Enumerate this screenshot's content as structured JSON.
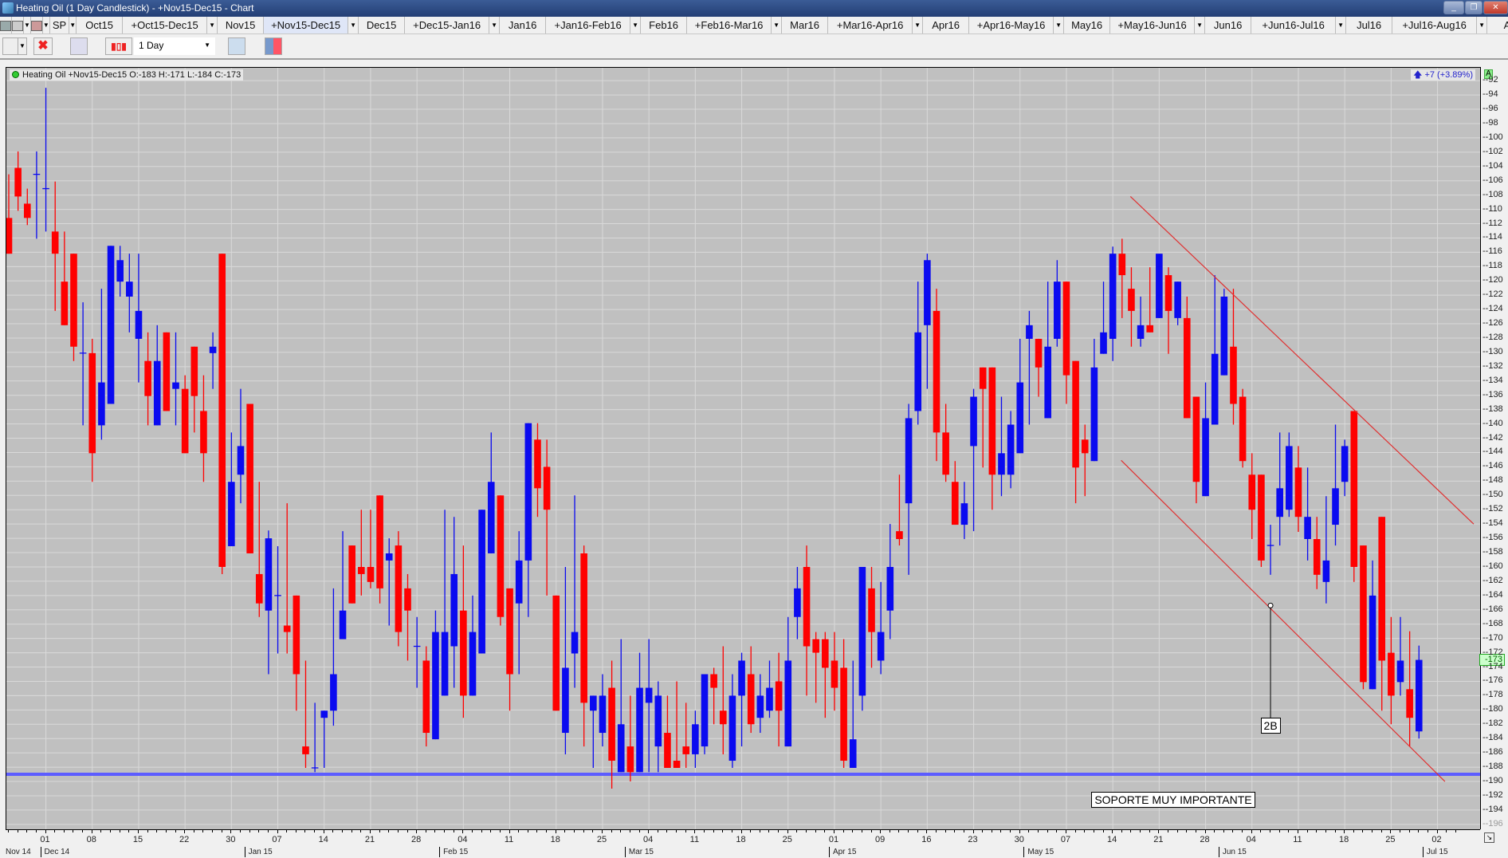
{
  "window": {
    "title": "Heating Oil (1 Day Candlestick) - +Nov15-Dec15 - Chart",
    "minimize": "_",
    "restore": "❐",
    "close": "✕"
  },
  "tabs": {
    "sp_label": "SP",
    "items": [
      {
        "label": "Oct15",
        "type": "plain"
      },
      {
        "label": "+Oct15-Dec15",
        "type": "spread"
      },
      {
        "label": "Nov15",
        "type": "plain"
      },
      {
        "label": "+Nov15-Dec15",
        "type": "spread",
        "selected": true
      },
      {
        "label": "Dec15",
        "type": "plain"
      },
      {
        "label": "+Dec15-Jan16",
        "type": "spread"
      },
      {
        "label": "Jan16",
        "type": "plain"
      },
      {
        "label": "+Jan16-Feb16",
        "type": "spread"
      },
      {
        "label": "Feb16",
        "type": "plain"
      },
      {
        "label": "+Feb16-Mar16",
        "type": "spread"
      },
      {
        "label": "Mar16",
        "type": "plain"
      },
      {
        "label": "+Mar16-Apr16",
        "type": "spread"
      },
      {
        "label": "Apr16",
        "type": "plain"
      },
      {
        "label": "+Apr16-May16",
        "type": "spread"
      },
      {
        "label": "May16",
        "type": "plain"
      },
      {
        "label": "+May16-Jun16",
        "type": "spread"
      },
      {
        "label": "Jun16",
        "type": "plain"
      },
      {
        "label": "+Jun16-Jul16",
        "type": "spread"
      },
      {
        "label": "Jul16",
        "type": "plain"
      },
      {
        "label": "+Jul16-Aug16",
        "type": "spread"
      },
      {
        "label": "Au",
        "type": "plain"
      }
    ]
  },
  "toolbar": {
    "interval": "1 Day"
  },
  "chart_header": {
    "legend": "Heating Oil +Nov15-Dec15 O:-183 H:-171 L:-184 C:-173",
    "change": "+7 (+3.89%)",
    "axis_badge": "A",
    "last_price": "-173"
  },
  "colors": {
    "up": "#0a0af0",
    "down": "#ff0000",
    "background": "#c0c0c0",
    "grid": "#d9d9d9",
    "support": "#5c5cff",
    "trendline": "#e03030"
  },
  "chart_data": {
    "type": "candlestick",
    "title": "Heating Oil +Nov15-Dec15",
    "ylim": [
      -90.2,
      -196.8
    ],
    "yticks_step": 2,
    "yticks_range": [
      -92,
      -196
    ],
    "grid": true,
    "ohlc": [
      [
        -111.2,
        -105.1,
        -116.2,
        -116.2
      ],
      [
        -104.2,
        -101.9,
        -110.2,
        -108.2
      ],
      [
        -109.2,
        -107.1,
        -112.2,
        -111.2
      ],
      [
        -105.1,
        -101.9,
        -114.1,
        -105.1
      ],
      [
        -107.1,
        -93,
        -113.1,
        -107.1
      ],
      [
        -113.1,
        -106.1,
        -124.2,
        -116.2
      ],
      [
        -120.1,
        -113.1,
        -126.2,
        -126.2
      ],
      [
        -116.2,
        -116.2,
        -131.2,
        -129.2
      ],
      [
        -130.1,
        -123,
        -140.2,
        -130.1
      ],
      [
        -130.1,
        -128.1,
        -148.1,
        -144.1
      ],
      [
        -140.2,
        -121.1,
        -142.2,
        -134.2
      ],
      [
        -137.2,
        -115.1,
        -137.2,
        -115.1
      ],
      [
        -120.1,
        -115.1,
        -122.2,
        -117.1
      ],
      [
        -122.2,
        -116.2,
        -127.2,
        -120.1
      ],
      [
        -128.1,
        -116.2,
        -134.2,
        -124.2
      ],
      [
        -131.2,
        -127.2,
        -140.2,
        -136.1
      ],
      [
        -140.2,
        -126.2,
        -140.2,
        -131.2
      ],
      [
        -127.2,
        -127.2,
        -138.2,
        -138.2
      ],
      [
        -135.1,
        -127.2,
        -140.2,
        -134.2
      ],
      [
        -135.1,
        -133.2,
        -144.1,
        -144.1
      ],
      [
        -129.2,
        -129.2,
        -141.2,
        -136.1
      ],
      [
        -138.2,
        -133.2,
        -148.1,
        -144.1
      ],
      [
        -130.1,
        -127.2,
        -135.1,
        -129.2
      ],
      [
        -116.2,
        -116.2,
        -161,
        -160
      ],
      [
        -157.1,
        -141.2,
        -157.1,
        -148.1
      ],
      [
        -147.1,
        -135.1,
        -151.1,
        -143.1
      ],
      [
        -137.2,
        -137.2,
        -158.1,
        -158.1
      ],
      [
        -161,
        -148.1,
        -167,
        -165.1
      ],
      [
        -166.1,
        -154.9,
        -175,
        -156
      ],
      [
        -164,
        -157.1,
        -172.1,
        -164
      ],
      [
        -168.2,
        -151.1,
        -172.1,
        -169.1
      ],
      [
        -164,
        -164,
        -180.1,
        -175
      ],
      [
        -185.1,
        -173.1,
        -188.1,
        -186.2
      ],
      [
        -188.1,
        -179,
        -188.7,
        -188.1
      ],
      [
        -181.1,
        -180.1,
        -188.1,
        -180.1
      ],
      [
        -180.1,
        -163,
        -182.2,
        -175
      ],
      [
        -170.1,
        -155,
        -170.1,
        -166.1
      ],
      [
        -157,
        -157,
        -165.1,
        -165.1
      ],
      [
        -160,
        -152,
        -164,
        -161
      ],
      [
        -160,
        -152,
        -163,
        -162.1
      ],
      [
        -150,
        -150,
        -165.1,
        -163
      ],
      [
        -159.1,
        -156,
        -168.2,
        -158.1
      ],
      [
        -157,
        -155,
        -171.1,
        -169.1
      ],
      [
        -163,
        -161,
        -173.1,
        -166.1
      ],
      [
        -171.1,
        -167,
        -176.9,
        -171.1
      ],
      [
        -173.1,
        -171.1,
        -185.1,
        -183.2
      ],
      [
        -184.1,
        -166.1,
        -184.1,
        -169.1
      ],
      [
        -178,
        -152,
        -178,
        -169.1
      ],
      [
        -171.1,
        -153,
        -176.9,
        -161
      ],
      [
        -166.1,
        -157,
        -181.1,
        -178
      ],
      [
        -178,
        -164,
        -178,
        -169.1
      ],
      [
        -172.1,
        -152,
        -172.1,
        -152
      ],
      [
        -158.1,
        -141.2,
        -158.1,
        -148.1
      ],
      [
        -150,
        -150,
        -168.2,
        -167
      ],
      [
        -163,
        -163,
        -180.1,
        -175
      ],
      [
        -165.1,
        -155,
        -175,
        -159.1
      ],
      [
        -159.1,
        -139.9,
        -167,
        -139.9
      ],
      [
        -142.2,
        -139.9,
        -153,
        -149
      ],
      [
        -146,
        -142.2,
        -164,
        -152
      ],
      [
        -164,
        -164,
        -180.1,
        -180.1
      ],
      [
        -183.2,
        -160,
        -186.2,
        -174.1
      ],
      [
        -172.1,
        -150,
        -176.9,
        -169.1
      ],
      [
        -158.1,
        -157,
        -185.1,
        -179
      ],
      [
        -180.1,
        -178,
        -188.1,
        -178
      ],
      [
        -183.2,
        -175,
        -185.1,
        -178
      ],
      [
        -176.9,
        -173.1,
        -191,
        -187.1
      ],
      [
        -188.7,
        -170.1,
        -188.7,
        -182
      ],
      [
        -185.1,
        -178,
        -190,
        -188.7
      ],
      [
        -188.7,
        -172,
        -188.7,
        -176.9
      ],
      [
        -179,
        -170.1,
        -188.7,
        -176.9
      ],
      [
        -185.1,
        -176,
        -188.7,
        -178
      ],
      [
        -183.2,
        -178,
        -188.1,
        -188.1
      ],
      [
        -187.1,
        -176,
        -188.1,
        -188.1
      ],
      [
        -185.1,
        -179,
        -188.1,
        -186.2
      ],
      [
        -186.2,
        -180.1,
        -188.1,
        -182
      ],
      [
        -185.1,
        -175,
        -186.2,
        -175
      ],
      [
        -175,
        -174.1,
        -182,
        -176.9
      ],
      [
        -180.1,
        -171.1,
        -186.2,
        -182
      ],
      [
        -187.1,
        -175,
        -188.1,
        -178
      ],
      [
        -178,
        -172,
        -185.1,
        -173.1
      ],
      [
        -175,
        -171.1,
        -183.2,
        -182
      ],
      [
        -181.1,
        -175,
        -183.2,
        -178
      ],
      [
        -180.1,
        -173.1,
        -181.1,
        -176.9
      ],
      [
        -176,
        -172,
        -185.1,
        -180.1
      ],
      [
        -185.1,
        -167,
        -185.1,
        -173.1
      ],
      [
        -167,
        -160,
        -170.1,
        -163
      ],
      [
        -160,
        -157,
        -178,
        -171.1
      ],
      [
        -170.1,
        -169.1,
        -179,
        -172
      ],
      [
        -170.1,
        -169.1,
        -181.1,
        -174.1
      ],
      [
        -173.1,
        -169.1,
        -180.1,
        -176.9
      ],
      [
        -174.1,
        -170.1,
        -188.1,
        -187.1
      ],
      [
        -188.1,
        -173.1,
        -188.1,
        -184.1
      ],
      [
        -178,
        -160,
        -180.1,
        -160
      ],
      [
        -163,
        -160,
        -174.1,
        -169.1
      ],
      [
        -173.1,
        -162.1,
        -175,
        -169.1
      ],
      [
        -166.1,
        -154,
        -170.1,
        -160
      ],
      [
        -155,
        -147.1,
        -157,
        -156.1
      ],
      [
        -151.1,
        -137.2,
        -161.1,
        -139.2
      ],
      [
        -138.2,
        -120.1,
        -140.1,
        -127.2
      ],
      [
        -126.2,
        -116.2,
        -135.1,
        -117.1
      ],
      [
        -124.2,
        -121.1,
        -145.2,
        -141.2
      ],
      [
        -141.2,
        -137.2,
        -148.1,
        -147.1
      ],
      [
        -148.1,
        -145.2,
        -154.1,
        -154.1
      ],
      [
        -154.1,
        -148.1,
        -156.1,
        -151.1
      ],
      [
        -143.1,
        -135.1,
        -155,
        -136.2
      ],
      [
        -132.1,
        -132.1,
        -146.1,
        -135.1
      ],
      [
        -132.1,
        -132.1,
        -152,
        -147.1
      ],
      [
        -147.1,
        -136.2,
        -150.1,
        -144.1
      ],
      [
        -147.1,
        -138.2,
        -149,
        -140.1
      ],
      [
        -144.1,
        -128.1,
        -144.1,
        -134.2
      ],
      [
        -128.1,
        -124.2,
        -140.1,
        -126.2
      ],
      [
        -128.1,
        -128.1,
        -136.2,
        -132.1
      ],
      [
        -139.2,
        -120.1,
        -139.2,
        -129.2
      ],
      [
        -128.1,
        -117.1,
        -129.2,
        -120.1
      ],
      [
        -120.1,
        -120.1,
        -137.2,
        -133.2
      ],
      [
        -131.2,
        -131.2,
        -151.1,
        -146.1
      ],
      [
        -142.2,
        -140.1,
        -150.1,
        -144.1
      ],
      [
        -145.2,
        -128.1,
        -145.2,
        -132.1
      ],
      [
        -130.2,
        -120.1,
        -130.2,
        -127.2
      ],
      [
        -128.1,
        -115.2,
        -131.2,
        -116.2
      ],
      [
        -116.2,
        -114.1,
        -125.2,
        -119.2
      ],
      [
        -121.1,
        -118.1,
        -129.2,
        -124.2
      ],
      [
        -128.1,
        -122.2,
        -129.2,
        -126.2
      ],
      [
        -126.2,
        -118.1,
        -127.2,
        -127.2
      ],
      [
        -125.2,
        -116.2,
        -125.2,
        -116.2
      ],
      [
        -119.2,
        -118.1,
        -130.2,
        -124.2
      ],
      [
        -125.2,
        -120.1,
        -126.2,
        -120.1
      ],
      [
        -125.2,
        -122.2,
        -139.2,
        -139.2
      ],
      [
        -136.2,
        -136.2,
        -151.1,
        -148.1
      ],
      [
        -150.1,
        -134.2,
        -150.1,
        -139.2
      ],
      [
        -140.1,
        -119.2,
        -140.1,
        -130.2
      ],
      [
        -133.2,
        -121.1,
        -133.2,
        -122.2
      ],
      [
        -129.2,
        -121.1,
        -140.1,
        -137.2
      ],
      [
        -136.2,
        -135.1,
        -146.1,
        -145.2
      ],
      [
        -147.1,
        -144.1,
        -156.1,
        -152
      ],
      [
        -147.1,
        -147.1,
        -160,
        -159.1
      ],
      [
        -157,
        -154.1,
        -161.1,
        -157
      ],
      [
        -153,
        -141.2,
        -157,
        -149
      ],
      [
        -152,
        -141.2,
        -153,
        -143.1
      ],
      [
        -146.1,
        -143.1,
        -155.1,
        -153
      ],
      [
        -156.1,
        -146.1,
        -159.1,
        -153
      ],
      [
        -156.1,
        -153,
        -163.1,
        -161.1
      ],
      [
        -162.1,
        -150.1,
        -165.1,
        -159.1
      ],
      [
        -154.1,
        -140.1,
        -157,
        -149
      ],
      [
        -148.1,
        -142.2,
        -150.1,
        -143.1
      ],
      [
        -138.2,
        -138.2,
        -162.1,
        -160
      ],
      [
        -157,
        -157,
        -177.1,
        -176.1
      ],
      [
        -177.1,
        -159.1,
        -177.1,
        -164
      ],
      [
        -153,
        -153,
        -180.1,
        -173.1
      ],
      [
        -172,
        -167,
        -182,
        -178
      ],
      [
        -176.1,
        -167,
        -178,
        -173.1
      ],
      [
        -177.1,
        -169,
        -185.1,
        -181.1
      ],
      [
        -183,
        -171,
        -184,
        -173
      ]
    ],
    "x_day_labels": [
      {
        "label": "01",
        "bar": 5
      },
      {
        "label": "08",
        "bar": 10
      },
      {
        "label": "15",
        "bar": 15
      },
      {
        "label": "22",
        "bar": 20
      },
      {
        "label": "30",
        "bar": 25
      },
      {
        "label": "07",
        "bar": 30
      },
      {
        "label": "14",
        "bar": 35
      },
      {
        "label": "21",
        "bar": 40
      },
      {
        "label": "28",
        "bar": 45
      },
      {
        "label": "04",
        "bar": 50
      },
      {
        "label": "11",
        "bar": 55
      },
      {
        "label": "18",
        "bar": 60
      },
      {
        "label": "25",
        "bar": 65
      },
      {
        "label": "04",
        "bar": 70
      },
      {
        "label": "11",
        "bar": 75
      },
      {
        "label": "18",
        "bar": 80
      },
      {
        "label": "25",
        "bar": 85
      },
      {
        "label": "01",
        "bar": 90
      },
      {
        "label": "09",
        "bar": 95
      },
      {
        "label": "16",
        "bar": 100
      },
      {
        "label": "23",
        "bar": 105
      },
      {
        "label": "30",
        "bar": 110
      },
      {
        "label": "07",
        "bar": 115
      },
      {
        "label": "14",
        "bar": 120
      },
      {
        "label": "21",
        "bar": 125
      },
      {
        "label": "28",
        "bar": 130
      },
      {
        "label": "04",
        "bar": 135
      },
      {
        "label": "11",
        "bar": 140
      },
      {
        "label": "18",
        "bar": 145
      },
      {
        "label": "25",
        "bar": 150
      },
      {
        "label": "02",
        "bar": 155
      }
    ],
    "x_month_labels": [
      {
        "label": "Nov 14",
        "bar": 0
      },
      {
        "label": "Dec 14",
        "bar": 5
      },
      {
        "label": "Jan 15",
        "bar": 27
      },
      {
        "label": "Feb 15",
        "bar": 48
      },
      {
        "label": "Mar 15",
        "bar": 68
      },
      {
        "label": "Apr 15",
        "bar": 90
      },
      {
        "label": "May 15",
        "bar": 111
      },
      {
        "label": "Jun 15",
        "bar": 132
      },
      {
        "label": "Jul 15",
        "bar": 154
      }
    ],
    "support_line": {
      "price": -189
    },
    "trendlines": [
      {
        "name": "upper-channel",
        "from": {
          "bar": 121.9,
          "price": -108.2
        },
        "to": {
          "bar": 158.9,
          "price": -154
        }
      },
      {
        "name": "lower-channel",
        "from": {
          "bar": 120.9,
          "price": -145.1
        },
        "to": {
          "bar": 155.8,
          "price": -190
        }
      }
    ],
    "annotations": [
      {
        "text": "2B",
        "anchor": {
          "bar": 137,
          "price": -165.4
        },
        "label_at": {
          "bar": 137,
          "price": -182.2
        }
      },
      {
        "text": "SOPORTE MUY IMPORTANTE",
        "label_at": {
          "bar": 126.5,
          "price": -192.6
        }
      }
    ]
  }
}
